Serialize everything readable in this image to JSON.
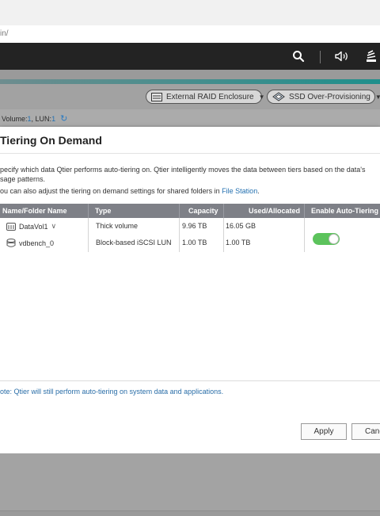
{
  "browser": {
    "address_text": "in/"
  },
  "topbar": {
    "icons": [
      "search-icon",
      "speaker-icon",
      "stack-icon"
    ]
  },
  "toolbar": {
    "external_raid_label": "External RAID Enclosure",
    "ssd_label": "SSD Over-Provisioning"
  },
  "volume_info": {
    "prefix": "Volume: ",
    "volume": "1",
    "sep": ", LUN: ",
    "lun": "1"
  },
  "dialog": {
    "title": "Tiering On Demand",
    "desc_line1": "pecify which data Qtier performs auto-tiering on. Qtier intelligently moves the data between tiers based on the data's",
    "desc_line2": "sage patterns.",
    "desc_line3_prefix": "ou can also adjust the tiering on demand settings for shared folders in ",
    "desc_link": "File Station",
    "desc_line3_suffix": ".",
    "columns": {
      "name": "Name/Folder Name",
      "type": "Type",
      "capacity": "Capacity",
      "used": "Used/Allocated",
      "auto": "Enable Auto-Tiering"
    },
    "rows": [
      {
        "name": "DataVol1",
        "type": "Thick volume",
        "capacity": "9.96 TB",
        "used": "16.05 GB",
        "auto_tiering": null
      },
      {
        "name": "vdbench_0",
        "type": "Block-based iSCSI LUN",
        "capacity": "1.00 TB",
        "used": "1.00 TB",
        "auto_tiering": true
      }
    ],
    "note": "ote: Qtier will still perform auto-tiering on system data and applications.",
    "apply_label": "Apply",
    "cancel_label": "Canc"
  },
  "colors": {
    "toggle_on": "#5cc35c",
    "header_bg": "#7e8087",
    "link": "#2370b0",
    "topbar": "#232323"
  }
}
